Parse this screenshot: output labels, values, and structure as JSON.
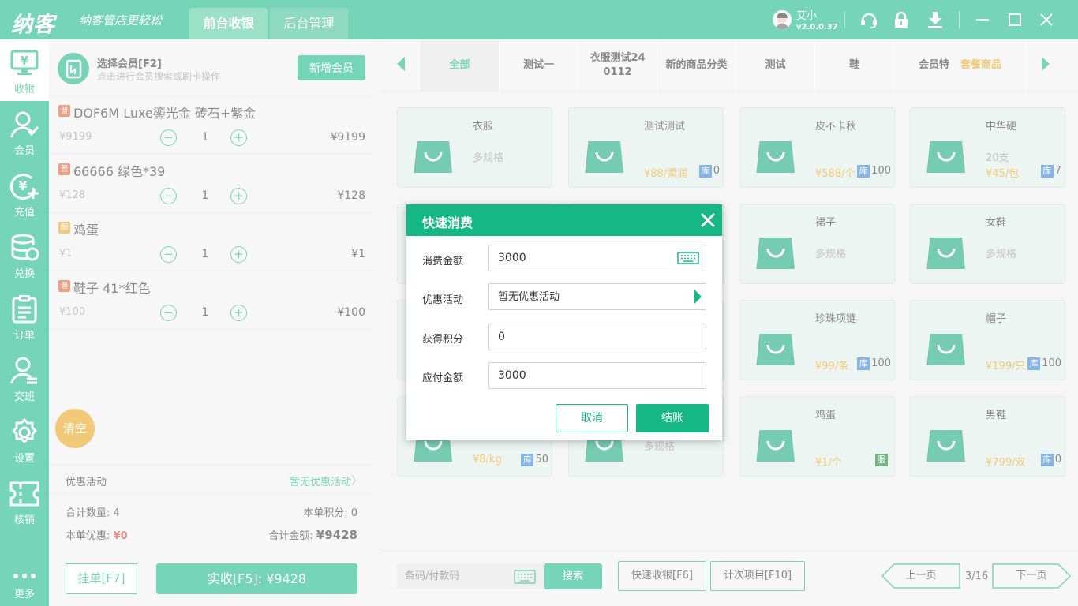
{
  "titlebar": {
    "logo": "纳客",
    "slogan": "纳客管店更轻松",
    "tabs": [
      "前台收银",
      "后台管理"
    ],
    "user_name": "艾小",
    "version": "v2.0.0.37"
  },
  "nav": [
    {
      "label": "收银",
      "icon": "cashier-icon"
    },
    {
      "label": "会员",
      "icon": "member-icon"
    },
    {
      "label": "充值",
      "icon": "recharge-icon"
    },
    {
      "label": "兑换",
      "icon": "exchange-icon"
    },
    {
      "label": "订单",
      "icon": "order-icon"
    },
    {
      "label": "交班",
      "icon": "handover-icon"
    },
    {
      "label": "设置",
      "icon": "settings-icon"
    },
    {
      "label": "核销",
      "icon": "verify-icon"
    },
    {
      "label": "更多",
      "icon": "more-icon"
    }
  ],
  "member": {
    "title": "选择会员[F2]",
    "subtitle": "点击进行会员搜索或刷卡操作",
    "add_button": "新增会员"
  },
  "cart": {
    "items": [
      {
        "badge": "普",
        "name": "DOF6M Luxe鎏光金 砖石+紫金",
        "price": "¥9199",
        "qty": "1",
        "total": "¥9199"
      },
      {
        "badge": "普",
        "name": "66666 绿色*39",
        "price": "¥128",
        "qty": "1",
        "total": "¥128"
      },
      {
        "badge": "服",
        "name": "鸡蛋",
        "price": "¥1",
        "qty": "1",
        "total": "¥1"
      },
      {
        "badge": "普",
        "name": "鞋子 41*红色",
        "price": "¥100",
        "qty": "1",
        "total": "¥100"
      }
    ],
    "clear_label": "清空",
    "promo_label": "优惠活动",
    "promo_value": "暂无优惠活动",
    "total_qty_label": "合计数量:",
    "total_qty": "4",
    "points_label": "本单积分:",
    "points": "0",
    "discount_label": "本单优惠:",
    "discount": "¥0",
    "total_amount_label": "合计金额:",
    "total_amount": "¥9428",
    "hang_button": "挂单[F7]",
    "pay_button": "实收[F5]: ¥9428"
  },
  "categories": {
    "tabs": [
      "全部",
      "测试一",
      "衣服测试240112",
      "新的商品分类",
      "测试",
      "鞋",
      "会员特"
    ],
    "extra_tab": "套餐商品"
  },
  "products": [
    {
      "name": "衣服",
      "spec": "多规格",
      "price": "",
      "stock_tag": "",
      "stock": ""
    },
    {
      "name": "测试测试",
      "spec": "",
      "price": "¥88/柔润",
      "stock_tag": "库",
      "stock": "0"
    },
    {
      "name": "皮不卡秋",
      "spec": "",
      "price": "¥588/个",
      "stock_tag": "库",
      "stock": "100"
    },
    {
      "name": "中华硬",
      "spec": "20支",
      "price": "¥45/包",
      "stock_tag": "库",
      "stock": "7"
    },
    {
      "name": "",
      "spec": "",
      "price": "",
      "stock_tag": "",
      "stock": ""
    },
    {
      "name": "",
      "spec": "",
      "price": "",
      "stock_tag": "",
      "stock": ""
    },
    {
      "name": "裙子",
      "spec": "多规格",
      "price": "",
      "stock_tag": "",
      "stock": ""
    },
    {
      "name": "女鞋",
      "spec": "多规格",
      "price": "",
      "stock_tag": "",
      "stock": ""
    },
    {
      "name": "",
      "spec": "",
      "price": "",
      "stock_tag": "",
      "stock": ""
    },
    {
      "name": "",
      "spec": "",
      "price": "",
      "stock_tag": "",
      "stock": ""
    },
    {
      "name": "珍珠项链",
      "spec": "",
      "price": "¥99/条",
      "stock_tag": "库",
      "stock": "100"
    },
    {
      "name": "帽子",
      "spec": "",
      "price": "¥199/只",
      "stock_tag": "库",
      "stock": "100"
    },
    {
      "name": "",
      "spec": "",
      "price": "¥8/kg",
      "stock_tag": "库",
      "stock": "50"
    },
    {
      "name": "",
      "spec": "多规格",
      "price": "",
      "stock_tag": "",
      "stock": ""
    },
    {
      "name": "鸡蛋",
      "spec": "",
      "price": "¥1/个",
      "stock_tag": "服",
      "stock": ""
    },
    {
      "name": "男鞋",
      "spec": "",
      "price": "¥799/双",
      "stock_tag": "库",
      "stock": "0"
    }
  ],
  "bottom": {
    "barcode_placeholder": "条码/付款码",
    "search_button": "搜索",
    "quick_cash_button": "快速收银[F6]",
    "count_item_button": "计次项目[F10]",
    "prev_button": "上一页",
    "page_info": "3/16",
    "next_button": "下一页"
  },
  "dialog": {
    "title": "快速消费",
    "amount_label": "消费金额",
    "amount_value": "3000",
    "promo_label": "优惠活动",
    "promo_value": "暂无优惠活动",
    "points_label": "获得积分",
    "points_value": "0",
    "payable_label": "应付金额",
    "payable_value": "3000",
    "cancel_button": "取消",
    "confirm_button": "结账"
  },
  "colors": {
    "brand": "#15b784",
    "orange": "#e8a317",
    "red": "#e53935",
    "stock_blue": "#2d7fd6"
  }
}
